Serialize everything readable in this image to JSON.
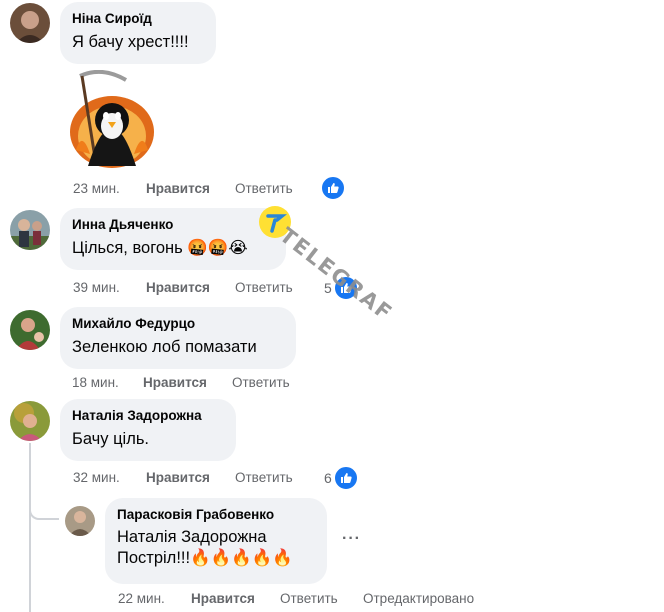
{
  "comments": [
    {
      "author": "Ніна Сироїд",
      "text": "Я бачу хрест!!!!",
      "time": "23 мин.",
      "like_label": "Нравится",
      "reply_label": "Ответить"
    },
    {
      "author": "Инна Дьяченко",
      "text": "Цільcя, вогонь 🤬🤬😭",
      "time": "39 мин.",
      "like_label": "Нравится",
      "reply_label": "Ответить",
      "reaction_count": "5"
    },
    {
      "author": "Михайло Федурцо",
      "text": "Зеленкою лоб помазати",
      "time": "18 мин.",
      "like_label": "Нравится",
      "reply_label": "Ответить"
    },
    {
      "author": "Наталія Задорожна",
      "text": "Бачу ціль.",
      "time": "32 мин.",
      "like_label": "Нравится",
      "reply_label": "Ответить",
      "reaction_count": "6"
    }
  ],
  "reply": {
    "author": "Парасковія Грабовенко",
    "mention": "Наталія Задорожна",
    "text": "Постріл!!!🔥🔥🔥🔥🔥",
    "time": "22 мин.",
    "like_label": "Нравится",
    "reply_label": "Ответить",
    "edited_label": "Отредактировано",
    "more_label": "···"
  },
  "watermark": {
    "text": "TELEGRAF",
    "logo_color": "#ffe033"
  },
  "colors": {
    "accent": "#1877f2",
    "bubble": "#f0f2f5",
    "meta": "#65676b"
  }
}
